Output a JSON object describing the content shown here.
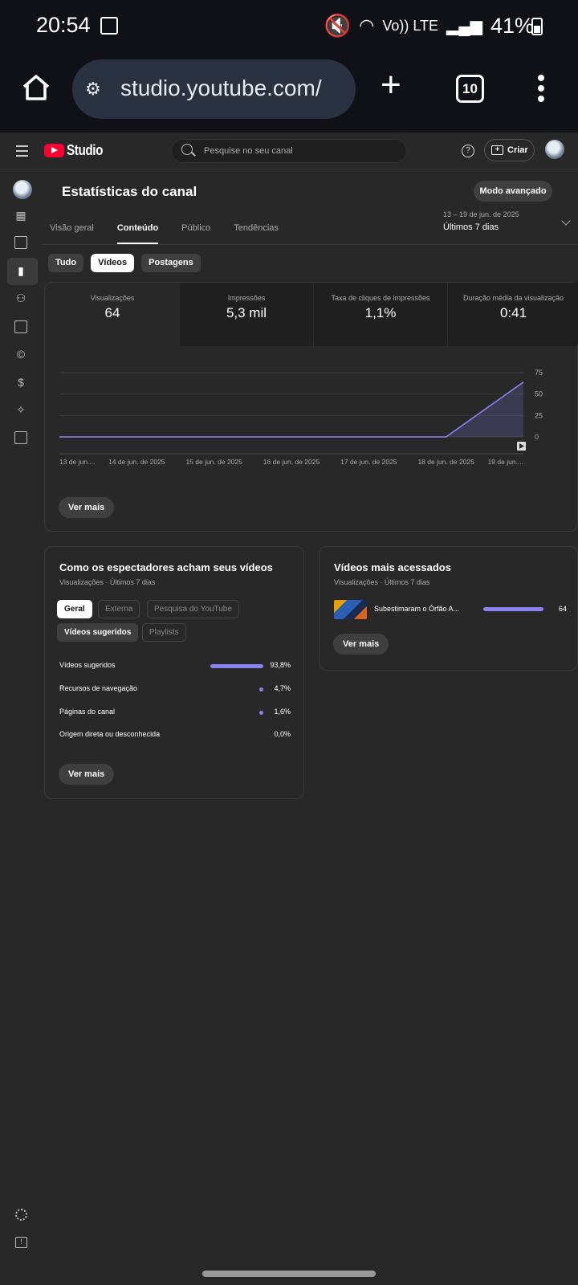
{
  "status_bar": {
    "time": "20:54",
    "volte": "Vo)) LTE",
    "battery": "41%"
  },
  "browser": {
    "url": "studio.youtube.com/",
    "tab_count": "10"
  },
  "header": {
    "logo_text": "Studio",
    "search_placeholder": "Pesquise no seu canal",
    "help": "?",
    "create_label": "Criar"
  },
  "page": {
    "title": "Estatísticas do canal",
    "advanced_button": "Modo avançado",
    "tabs": [
      "Visão geral",
      "Conteúdo",
      "Público",
      "Tendências"
    ],
    "active_tab": "Conteúdo",
    "date_range": "13 – 19 de jun. de 2025",
    "period": "Últimos 7 dias",
    "content_chips": [
      "Tudo",
      "Vídeos",
      "Postagens"
    ],
    "selected_chip": "Vídeos"
  },
  "metrics": [
    {
      "label": "Visualizações",
      "value": "64"
    },
    {
      "label": "Impressões",
      "value": "5,3 mil"
    },
    {
      "label": "Taxa de cliques de impressões",
      "value": "1,1%"
    },
    {
      "label": "Duração média da visualização",
      "value": "0:41"
    }
  ],
  "chart_data": {
    "type": "area",
    "categories": [
      "13 de jun....",
      "14 de jun. de 2025",
      "15 de jun. de 2025",
      "16 de jun. de 2025",
      "17 de jun. de 2025",
      "18 de jun. de 2025",
      "19 de jun...."
    ],
    "series": [
      {
        "values": [
          0,
          0,
          0,
          0,
          0,
          0,
          64
        ]
      }
    ],
    "yticks": [
      "75",
      "50",
      "25",
      "0"
    ],
    "ylim": [
      0,
      75
    ],
    "color": "#8b83f0"
  },
  "ver_mais": "Ver mais",
  "traffic_card": {
    "title": "Como os espectadores acham seus vídeos",
    "subtitle": "Visualizações · Últimos 7 dias",
    "chips": [
      "Geral",
      "Externa",
      "Pesquisa do YouTube",
      "Vídeos sugeridos",
      "Playlists"
    ],
    "rows": [
      {
        "name": "Vídeos sugeridos",
        "pct": "93,8%",
        "value": 93.8
      },
      {
        "name": "Recursos de navegação",
        "pct": "4,7%",
        "value": 4.7
      },
      {
        "name": "Páginas do canal",
        "pct": "1,6%",
        "value": 1.6
      },
      {
        "name": "Origem direta ou desconhecida",
        "pct": "0,0%",
        "value": 0
      }
    ]
  },
  "top_videos_card": {
    "title": "Vídeos mais acessados",
    "subtitle": "Visualizações · Últimos 7 dias",
    "videos": [
      {
        "title": "Subestimaram o Órfão A...",
        "views": "64"
      }
    ]
  },
  "colors": {
    "accent": "#8b83f0",
    "brand_red": "#ff0033",
    "background": "#282828"
  }
}
